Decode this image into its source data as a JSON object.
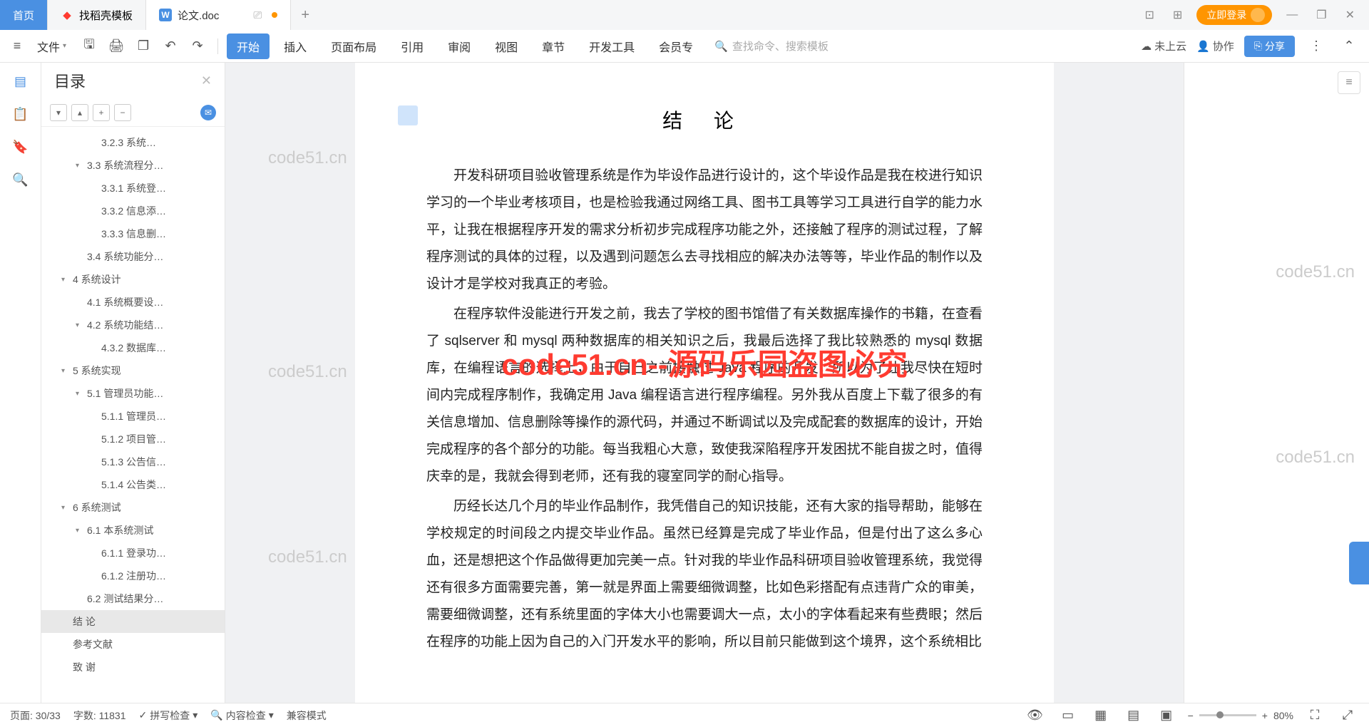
{
  "titlebar": {
    "home": "首页",
    "tab1": "找稻壳模板",
    "tab2": "论文.doc",
    "plus": "+",
    "login": "立即登录",
    "minimize": "—",
    "maximize": "❐",
    "close": "✕",
    "split_icon": "⊡",
    "apps_icon": "⊞"
  },
  "ribbon": {
    "file": "文件",
    "tabs": [
      "开始",
      "插入",
      "页面布局",
      "引用",
      "审阅",
      "视图",
      "章节",
      "开发工具",
      "会员专"
    ],
    "active_tab_index": 0,
    "search_placeholder": "查找命令、搜索模板",
    "cloud": "未上云",
    "collab": "协作",
    "share": "分享"
  },
  "sidebar": {
    "title": "目录",
    "close": "✕",
    "tools": [
      "▾",
      "▴",
      "+",
      "−"
    ],
    "items": [
      {
        "lvl": 3,
        "chev": "",
        "label": "3.2.3 系统…"
      },
      {
        "lvl": 2,
        "chev": "▾",
        "label": "3.3 系统流程分…"
      },
      {
        "lvl": 3,
        "chev": "",
        "label": "3.3.1 系统登…"
      },
      {
        "lvl": 3,
        "chev": "",
        "label": "3.3.2 信息添…"
      },
      {
        "lvl": 3,
        "chev": "",
        "label": "3.3.3 信息删…"
      },
      {
        "lvl": 2,
        "chev": "",
        "label": "3.4 系统功能分…"
      },
      {
        "lvl": 1,
        "chev": "▾",
        "label": "4 系统设计"
      },
      {
        "lvl": 2,
        "chev": "",
        "label": "4.1 系统概要设…"
      },
      {
        "lvl": 2,
        "chev": "▾",
        "label": "4.2 系统功能结…"
      },
      {
        "lvl": 3,
        "chev": "",
        "label": "4.3.2 数据库…"
      },
      {
        "lvl": 1,
        "chev": "▾",
        "label": "5 系统实现"
      },
      {
        "lvl": 2,
        "chev": "▾",
        "label": "5.1 管理员功能…"
      },
      {
        "lvl": 3,
        "chev": "",
        "label": "5.1.1 管理员…"
      },
      {
        "lvl": 3,
        "chev": "",
        "label": "5.1.2 项目管…"
      },
      {
        "lvl": 3,
        "chev": "",
        "label": "5.1.3 公告信…"
      },
      {
        "lvl": 3,
        "chev": "",
        "label": "5.1.4 公告类…"
      },
      {
        "lvl": 1,
        "chev": "▾",
        "label": "6 系统测试"
      },
      {
        "lvl": 2,
        "chev": "▾",
        "label": "6.1 本系统测试"
      },
      {
        "lvl": 3,
        "chev": "",
        "label": "6.1.1 登录功…"
      },
      {
        "lvl": 3,
        "chev": "",
        "label": "6.1.2 注册功…"
      },
      {
        "lvl": 2,
        "chev": "",
        "label": "6.2 测试结果分…"
      },
      {
        "lvl": 1,
        "chev": "",
        "label": "结  论",
        "selected": true
      },
      {
        "lvl": 1,
        "chev": "",
        "label": "参考文献"
      },
      {
        "lvl": 1,
        "chev": "",
        "label": "致  谢"
      }
    ]
  },
  "doc": {
    "title": "结 论",
    "p1": "开发科研项目验收管理系统是作为毕设作品进行设计的，这个毕设作品是我在校进行知识学习的一个毕业考核项目，也是检验我通过网络工具、图书工具等学习工具进行自学的能力水平，让我在根据程序开发的需求分析初步完成程序功能之外，还接触了程序的测试过程，了解程序测试的具体的过程，以及遇到问题怎么去寻找相应的解决办法等等，毕业作品的制作以及设计才是学校对我真正的考验。",
    "p2": "在程序软件没能进行开发之前，我去了学校的图书馆借了有关数据库操作的书籍，在查看了 sqlserver 和 mysql 两种数据库的相关知识之后，我最后选择了我比较熟悉的 mysql 数据库，在编程语言的选择上，由于自己之前接触过 Java 程序的开发，所以为了让我尽快在短时间内完成程序制作，我确定用 Java 编程语言进行程序编程。另外我从百度上下载了很多的有关信息增加、信息删除等操作的源代码，并通过不断调试以及完成配套的数据库的设计，开始完成程序的各个部分的功能。每当我粗心大意，致使我深陷程序开发困扰不能自拔之时，值得庆幸的是，我就会得到老师，还有我的寝室同学的耐心指导。",
    "p3": "历经长达几个月的毕业作品制作，我凭借自己的知识技能，还有大家的指导帮助，能够在学校规定的时间段之内提交毕业作品。虽然已经算是完成了毕业作品，但是付出了这么多心血，还是想把这个作品做得更加完美一点。针对我的毕业作品科研项目验收管理系统，我觉得还有很多方面需要完善，第一就是界面上需要细微调整，比如色彩搭配有点违背广众的审美，需要细微调整，还有系统里面的字体大小也需要调大一点，太小的字体看起来有些费眼；然后在程序的功能上因为自己的入门开发水平的影响，所以目前只能做到这个境界，这个系统相比"
  },
  "watermark": {
    "red": "code51.cn--源码乐园盗图必究",
    "grey": "code51.cn"
  },
  "status": {
    "page": "页面: 30/33",
    "words": "字数: 11831",
    "spellcheck": "拼写检查",
    "contentcheck": "内容检查",
    "compat": "兼容模式",
    "zoom": "80%"
  }
}
